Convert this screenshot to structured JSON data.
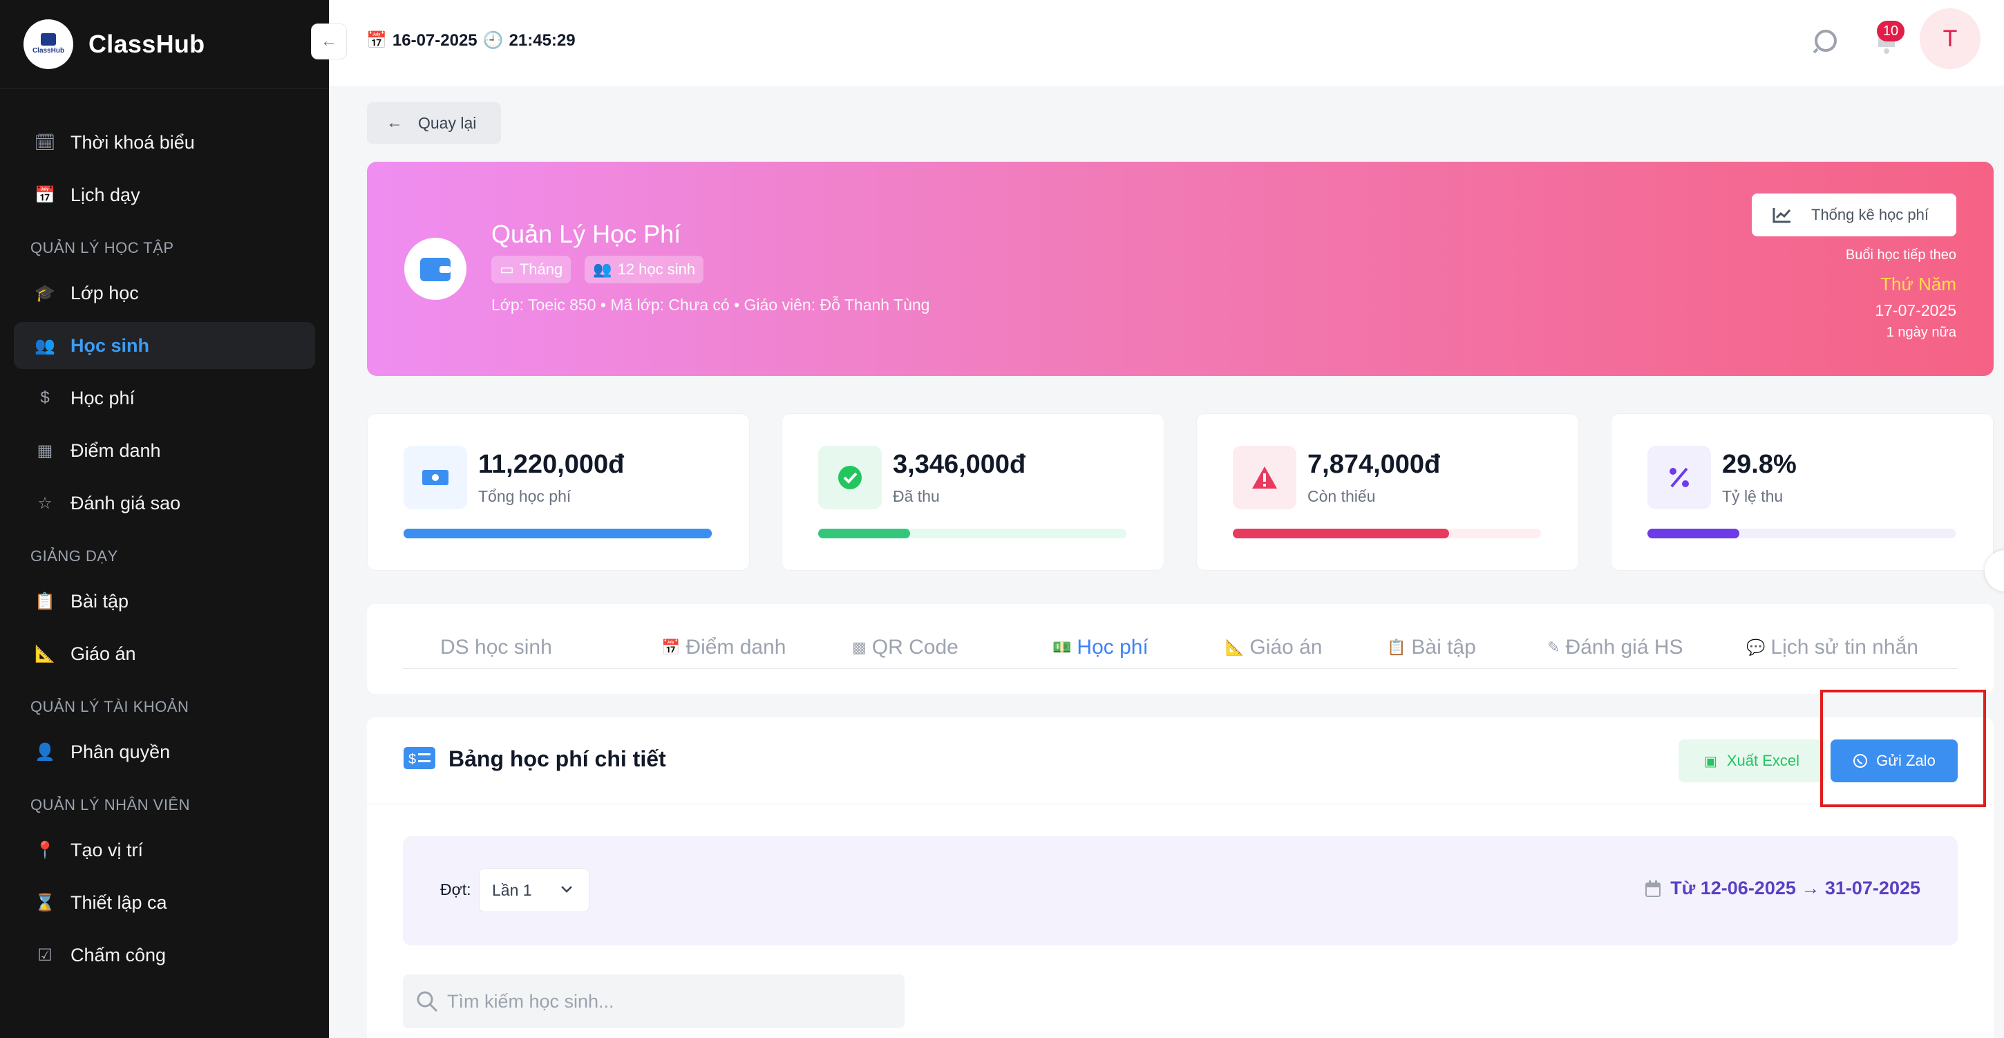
{
  "brand": {
    "name": "ClassHub",
    "logo_text": "ClassHub"
  },
  "sidebar": {
    "top_items": [
      {
        "label": "Thời khoá biểu",
        "icon": "calendar-clock-icon"
      },
      {
        "label": "Lịch dạy",
        "icon": "calendar-icon"
      }
    ],
    "sections": [
      {
        "title": "QUẢN LÝ HỌC TẬP",
        "items": [
          {
            "label": "Lớp học",
            "icon": "graduation-cap-icon"
          },
          {
            "label": "Học sinh",
            "icon": "users-icon",
            "active": true
          },
          {
            "label": "Học phí",
            "icon": "dollar-icon"
          },
          {
            "label": "Điểm danh",
            "icon": "calendar-grid-icon"
          },
          {
            "label": "Đánh giá sao",
            "icon": "star-icon"
          }
        ]
      },
      {
        "title": "GIẢNG DẠY",
        "items": [
          {
            "label": "Bài tập",
            "icon": "clipboard-icon"
          },
          {
            "label": "Giáo án",
            "icon": "ruler-icon"
          }
        ]
      },
      {
        "title": "QUẢN LÝ TÀI KHOẢN",
        "items": [
          {
            "label": "Phân quyền",
            "icon": "user-lock-icon"
          }
        ]
      },
      {
        "title": "QUẢN LÝ NHÂN VIÊN",
        "items": [
          {
            "label": "Tạo vị trí",
            "icon": "location-pin-icon"
          },
          {
            "label": "Thiết lập ca",
            "icon": "hourglass-icon"
          },
          {
            "label": "Chấm công",
            "icon": "checkbox-icon"
          }
        ]
      }
    ]
  },
  "topbar": {
    "date": "16-07-2025",
    "time": "21:45:29",
    "notifications": "10",
    "avatar_letter": "T"
  },
  "back_label": "Quay lại",
  "hero": {
    "title": "Quản Lý Học Phí",
    "tag_period": "Tháng",
    "tag_students": "12 học sinh",
    "info": "Lớp: Toeic 850 • Mã lớp: Chưa có • Giáo viên: Đỗ Thanh Tùng",
    "stats_button": "Thống kê học phí",
    "next_label": "Buổi học tiếp theo",
    "next_day": "Thứ Năm",
    "next_date": "17-07-2025",
    "next_relative": "1 ngày nữa"
  },
  "stats": [
    {
      "value": "11,220,000đ",
      "label": "Tổng học phí",
      "icon": "money-icon",
      "fill": 1.0,
      "color": "#3b8ff0",
      "track": "#3b8ff0",
      "bg": "#eff6ff"
    },
    {
      "value": "3,346,000đ",
      "label": "Đã thu",
      "icon": "check-circle-icon",
      "fill": 0.298,
      "color": "#34c77b",
      "track": "#e3faef",
      "bg": "#e7f8ef"
    },
    {
      "value": "7,874,000đ",
      "label": "Còn thiếu",
      "icon": "warning-icon",
      "fill": 0.702,
      "color": "#e8395f",
      "track": "#feeef2",
      "bg": "#fdecef"
    },
    {
      "value": "29.8%",
      "label": "Tỷ lệ thu",
      "icon": "percent-icon",
      "fill": 0.298,
      "color": "#6d3be8",
      "track": "#f1effb",
      "bg": "#f3f0fd"
    }
  ],
  "tabs": [
    {
      "label": "DS học sinh",
      "icon": ""
    },
    {
      "label": "Điểm danh",
      "icon": "calendar-icon"
    },
    {
      "label": "QR Code",
      "icon": "qr-icon"
    },
    {
      "label": "Học phí",
      "icon": "money-icon",
      "active": true
    },
    {
      "label": "Giáo án",
      "icon": "ruler-icon"
    },
    {
      "label": "Bài tập",
      "icon": "clipboard-icon"
    },
    {
      "label": "Đánh giá HS",
      "icon": "edit-icon"
    },
    {
      "label": "Lịch sử tin nhắn",
      "icon": "chat-icon"
    }
  ],
  "panel": {
    "title": "Bảng học phí chi tiết",
    "excel_button": "Xuất Excel",
    "zalo_button": "Gửi Zalo",
    "filter_label": "Đợt:",
    "filter_value": "Lần 1",
    "date_range": "Từ 12-06-2025 → 31-07-2025",
    "search_placeholder": "Tìm kiếm học sinh..."
  }
}
